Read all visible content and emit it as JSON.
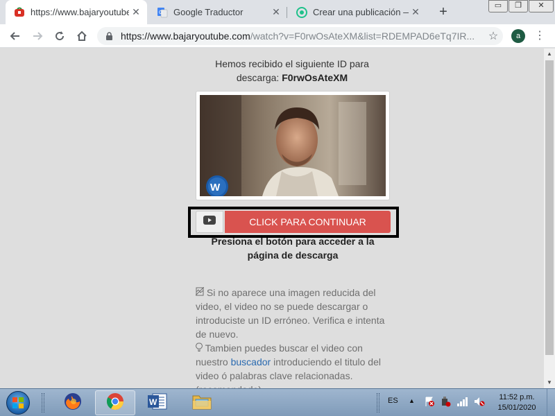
{
  "browser": {
    "tabs": [
      {
        "title": "https://www.bajaryoutube",
        "icon": "bajaryoutube-favicon-icon",
        "active": true
      },
      {
        "title": "Google Traductor",
        "icon": "google-translate-icon",
        "active": false
      },
      {
        "title": "Crear una publicación — S",
        "icon": "publication-favicon-icon",
        "active": false
      }
    ],
    "new_tab_label": "+",
    "url_host": "https://www.bajaryoutube.com",
    "url_path": "/watch?v=F0rwOsAteXM&list=RDEMPAD6eTq7IR...",
    "avatar_letter": "a"
  },
  "page": {
    "id_line1": "Hemos recibido el siguiente ID para",
    "id_line2_prefix": "descarga: ",
    "video_id": "F0rwOsAteXM",
    "continue_button": "CLICK PARA CONTINUAR",
    "instruction": "Presiona el botón para acceder a la página de descarga",
    "info1": "Si no aparece una imagen reducida del video, el video no se puede descargar o introduciste un ID erróneo. Verifica e intenta de nuevo.",
    "info2_before": "Tambien puedes buscar el video con nuestro ",
    "info2_link": "buscador",
    "info2_after": " introduciendo el titulo del video ó palabras clave relacionadas. (recomendado)"
  },
  "taskbar": {
    "language": "ES",
    "time": "11:52 p.m.",
    "date": "15/01/2020",
    "pinned": [
      "firefox-icon",
      "chrome-icon",
      "word-icon",
      "file-explorer-icon"
    ]
  },
  "colors": {
    "accent_red": "#d9534f",
    "link_blue": "#2a6ab0",
    "page_bg": "#dedede"
  }
}
